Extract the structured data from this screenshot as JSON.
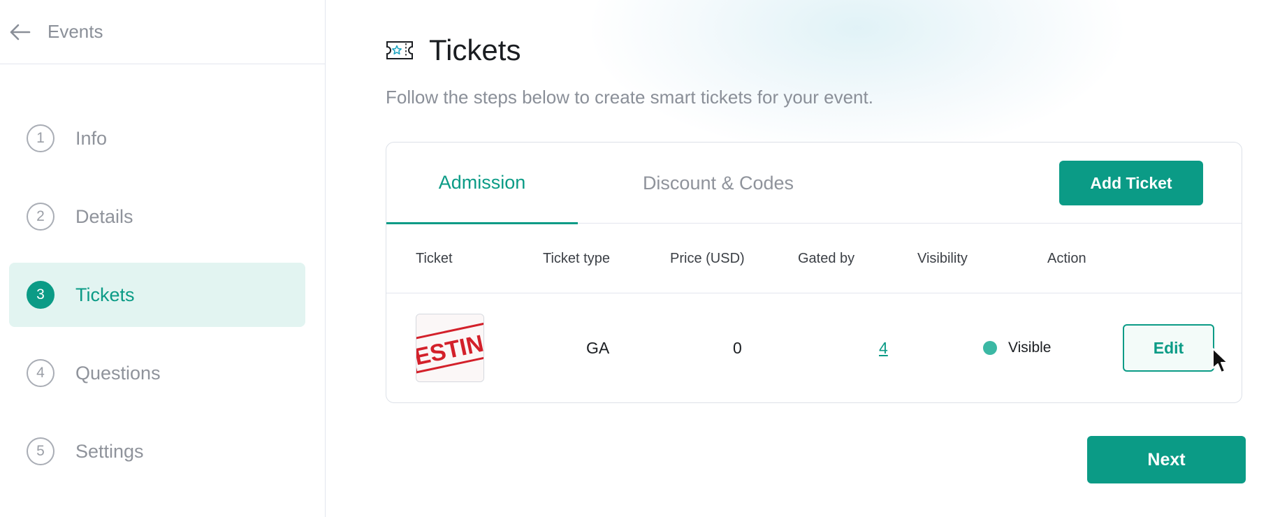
{
  "sidebar": {
    "back_label": "Events",
    "steps": [
      {
        "number": "1",
        "label": "Info"
      },
      {
        "number": "2",
        "label": "Details"
      },
      {
        "number": "3",
        "label": "Tickets"
      },
      {
        "number": "4",
        "label": "Questions"
      },
      {
        "number": "5",
        "label": "Settings"
      }
    ],
    "active_step": "Tickets"
  },
  "main": {
    "title": "Tickets",
    "title_icon": "ticket-icon",
    "subtitle": "Follow the steps below to create smart tickets for your event.",
    "tabs": [
      {
        "label": "Admission",
        "active": true
      },
      {
        "label": "Discount & Codes",
        "active": false
      }
    ],
    "add_ticket_label": "Add Ticket",
    "table": {
      "columns": [
        "Ticket",
        "Ticket type",
        "Price (USD)",
        "Gated by",
        "Visibility",
        "Action"
      ],
      "rows": [
        {
          "thumbnail_text": "TESTING",
          "ticket_type": "GA",
          "price": "0",
          "gated_by": "4",
          "visibility": "Visible",
          "action_label": "Edit"
        }
      ]
    },
    "next_label": "Next"
  },
  "colors": {
    "accent": "#0b9b86",
    "active_bg": "#e2f4f1",
    "muted_text": "#8f939b",
    "visible_dot": "#3bb8a4",
    "stamp_red": "#d3202a"
  }
}
